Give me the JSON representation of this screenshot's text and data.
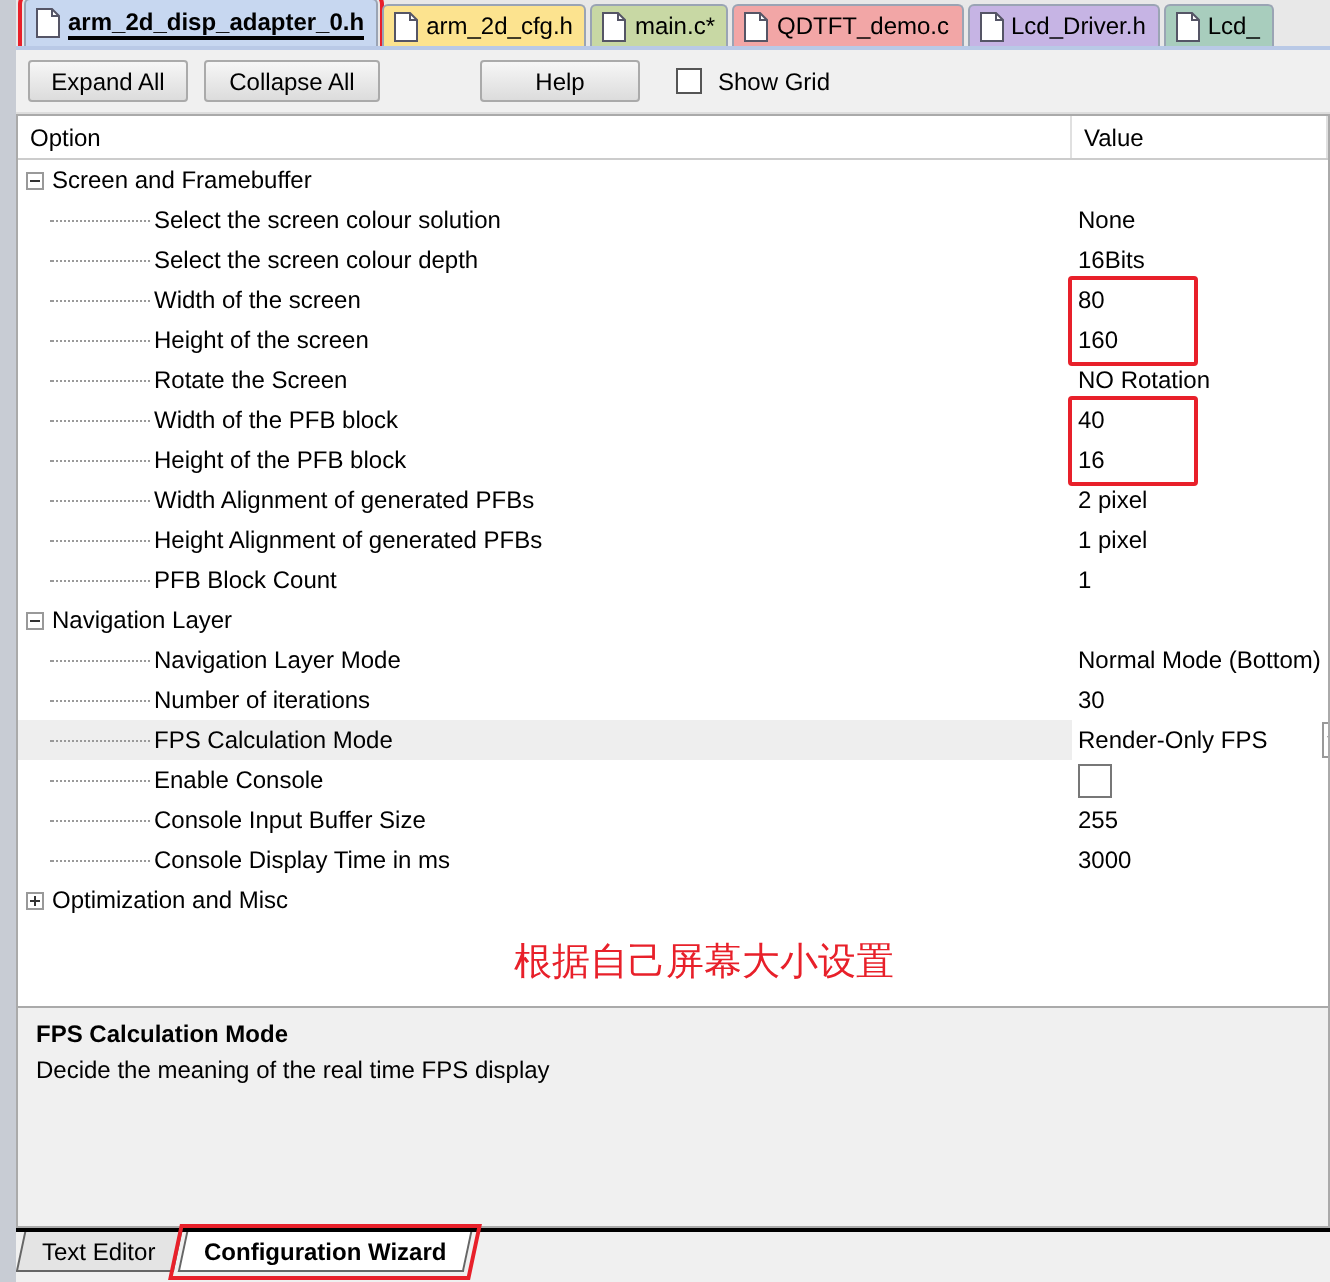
{
  "file_tabs": [
    {
      "label": "arm_2d_disp_adapter_0.h",
      "selected": true,
      "color": "#c7d7f0",
      "highlight": true
    },
    {
      "label": "arm_2d_cfg.h",
      "selected": false,
      "color": "#fce38f",
      "highlight": false
    },
    {
      "label": "main.c*",
      "selected": false,
      "color": "#c8d8a4",
      "highlight": false
    },
    {
      "label": "QDTFT_demo.c",
      "selected": false,
      "color": "#f2a6a6",
      "highlight": false
    },
    {
      "label": "Lcd_Driver.h",
      "selected": false,
      "color": "#c6b4e4",
      "highlight": false
    },
    {
      "label": "Lcd_",
      "selected": false,
      "color": "#a8cdbd",
      "highlight": false
    }
  ],
  "toolbar": {
    "buttons": [
      "Expand All",
      "Collapse All",
      "Help"
    ],
    "show_grid": {
      "label": "Show Grid",
      "checked": false
    }
  },
  "table": {
    "columns": [
      "Option",
      "Value"
    ],
    "sections": [
      {
        "label": "Screen and Framebuffer",
        "expanded": true,
        "items": [
          {
            "label": "Select the screen colour solution",
            "kind": "text",
            "value": "None",
            "boxed": false,
            "selected": false
          },
          {
            "label": "Select the screen colour depth",
            "kind": "text",
            "value": "16Bits",
            "boxed": false,
            "selected": false
          },
          {
            "label": "Width of the screen",
            "kind": "text",
            "value": "80",
            "boxed": true,
            "selected": false
          },
          {
            "label": "Height of the screen",
            "kind": "text",
            "value": "160",
            "boxed": true,
            "selected": false
          },
          {
            "label": "Rotate the Screen",
            "kind": "text",
            "value": "NO Rotation",
            "boxed": false,
            "selected": false
          },
          {
            "label": "Width of the PFB block",
            "kind": "text",
            "value": "40",
            "boxed": true,
            "selected": false
          },
          {
            "label": "Height of the PFB block",
            "kind": "text",
            "value": "16",
            "boxed": true,
            "selected": false
          },
          {
            "label": "Width Alignment of generated PFBs",
            "kind": "text",
            "value": "2 pixel",
            "boxed": false,
            "selected": false
          },
          {
            "label": "Height Alignment of generated PFBs",
            "kind": "text",
            "value": "1 pixel",
            "boxed": false,
            "selected": false
          },
          {
            "label": "PFB Block Count",
            "kind": "text",
            "value": "1",
            "boxed": false,
            "selected": false
          }
        ]
      },
      {
        "label": "Navigation Layer",
        "expanded": true,
        "items": [
          {
            "label": "Navigation Layer Mode",
            "kind": "text",
            "value": "Normal Mode (Bottom)",
            "boxed": false,
            "selected": false
          },
          {
            "label": "Number of iterations",
            "kind": "text",
            "value": "30",
            "boxed": false,
            "selected": false
          },
          {
            "label": "FPS Calculation Mode",
            "kind": "dropdown",
            "value": "Render-Only FPS",
            "boxed": false,
            "selected": true
          },
          {
            "label": "Enable Console",
            "kind": "checkbox",
            "checked": false,
            "boxed": false,
            "selected": false
          },
          {
            "label": "Console Input Buffer Size",
            "kind": "text",
            "value": "255",
            "boxed": false,
            "selected": false
          },
          {
            "label": "Console Display Time in ms",
            "kind": "text",
            "value": "3000",
            "boxed": false,
            "selected": false
          }
        ]
      },
      {
        "label": "Optimization and Misc",
        "expanded": false
      }
    ]
  },
  "note": "根据自己屏幕大小设置",
  "description": {
    "title": "FPS Calculation Mode",
    "text": "Decide the meaning of the real time FPS display"
  },
  "bottom_tabs": [
    {
      "label": "Text Editor",
      "selected": false,
      "highlight": false
    },
    {
      "label": "Configuration Wizard",
      "selected": true,
      "highlight": true
    }
  ]
}
